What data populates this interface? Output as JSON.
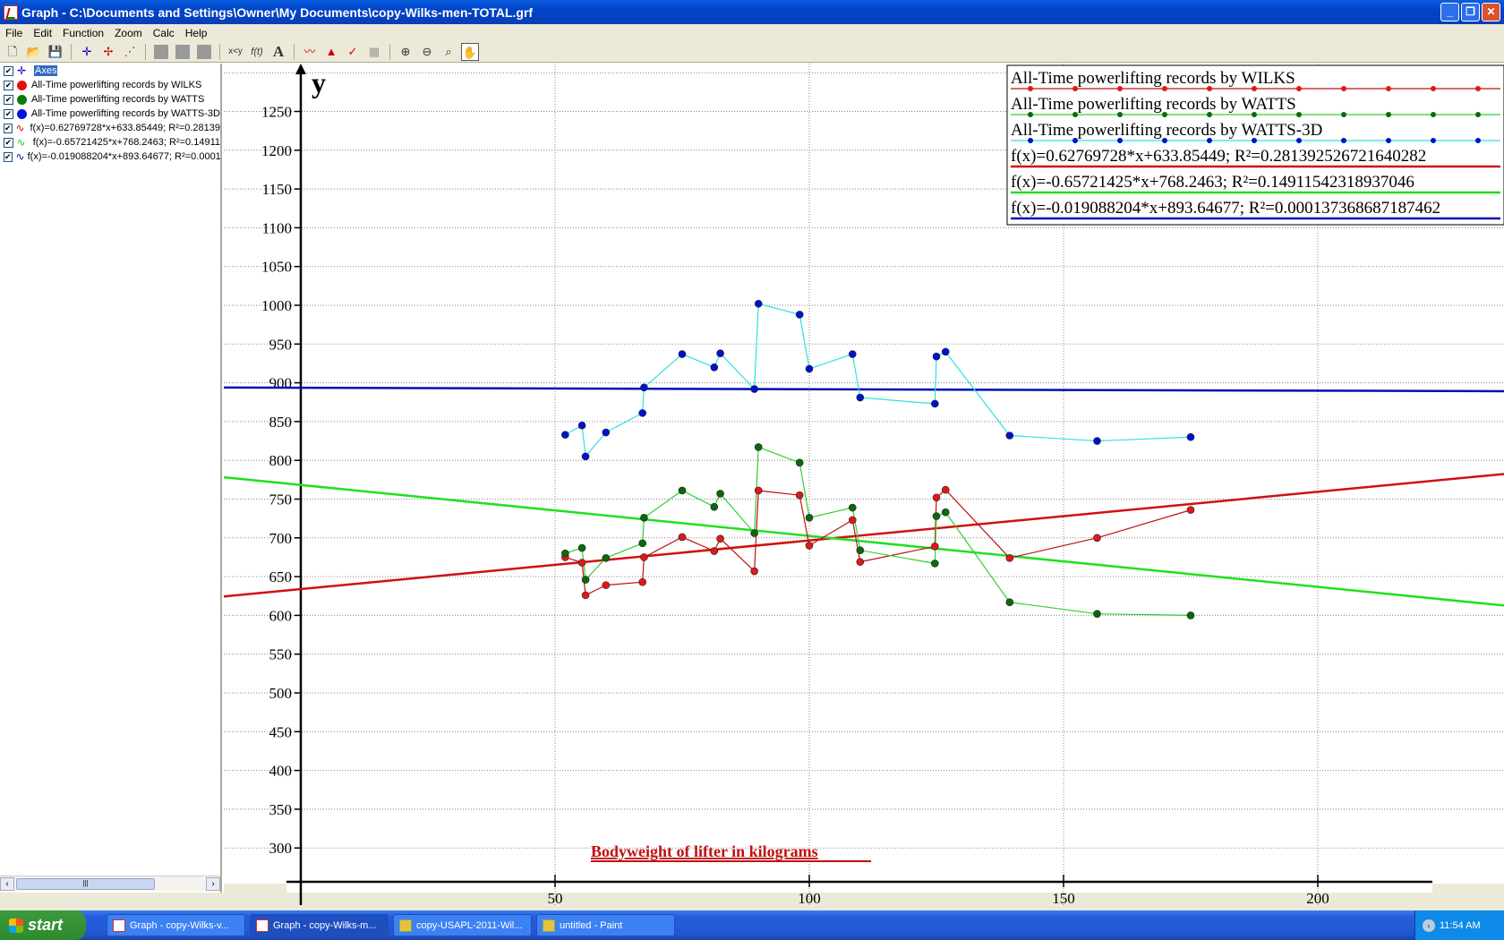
{
  "window": {
    "title": "Graph - C:\\Documents and Settings\\Owner\\My Documents\\copy-Wilks-men-TOTAL.grf",
    "buttons": [
      "minimize",
      "restore",
      "close"
    ]
  },
  "menu": [
    "File",
    "Edit",
    "Function",
    "Zoom",
    "Calc",
    "Help"
  ],
  "toolbar": {
    "text_buttons": [
      "x<y",
      "f(t)",
      "A"
    ]
  },
  "sidebar": {
    "items": [
      {
        "label": "Axes",
        "type": "axes",
        "color": "#0000c0",
        "selected": true
      },
      {
        "label": "All-Time powerlifting records by WILKS",
        "type": "point",
        "color": "#e01010"
      },
      {
        "label": "All-Time powerlifting records by WATTS",
        "type": "point",
        "color": "#0a7a0a"
      },
      {
        "label": "All-Time powerlifting records by WATTS-3D",
        "type": "point",
        "color": "#0010e0"
      },
      {
        "label": "f(x)=0.62769728*x+633.85449; R²=0.28139",
        "type": "func",
        "color": "#d01010"
      },
      {
        "label": "f(x)=-0.65721425*x+768.2463; R²=0.14911",
        "type": "func",
        "color": "#20d020"
      },
      {
        "label": "f(x)=-0.019088204*x+893.64677; R²=0.0001",
        "type": "func",
        "color": "#0010b0"
      }
    ]
  },
  "taskbar": {
    "start": "start",
    "tasks": [
      {
        "label": "Graph - copy-Wilks-v...",
        "icon": "graph",
        "active": false
      },
      {
        "label": "Graph - copy-Wilks-m...",
        "icon": "graph",
        "active": true
      },
      {
        "label": "copy-USAPL-2011-Wil...",
        "icon": "paint",
        "active": false
      },
      {
        "label": "untitled - Paint",
        "icon": "paint",
        "active": false
      }
    ],
    "clock": "11:54 AM"
  },
  "chart_data": {
    "type": "scatter",
    "title": "",
    "xlabel": "Bodyweight  of  lifter  in  kilograms",
    "ylabel": "y",
    "xlim": [
      -4,
      218
    ],
    "ylim": [
      250,
      1290
    ],
    "xticks": [
      50,
      100,
      150,
      200
    ],
    "yticks": [
      300,
      350,
      400,
      450,
      500,
      550,
      600,
      650,
      700,
      750,
      800,
      850,
      900,
      950,
      1000,
      1050,
      1100,
      1150,
      1200,
      1250
    ],
    "grid": true,
    "legend_position": "top-right",
    "series": [
      {
        "name": "All-Time powerlifting records by WILKS",
        "line_color": "#c01010",
        "marker_color": "#e01818",
        "x": [
          52,
          55.3,
          56,
          60,
          67.2,
          67.5,
          75,
          81.3,
          82.5,
          89.2,
          90,
          98.1,
          100,
          108.5,
          110,
          124.7,
          125,
          126.8,
          139.4,
          156.6,
          175
        ],
        "y": [
          675,
          668,
          626,
          639,
          643,
          675,
          701,
          683,
          699,
          657,
          761,
          755,
          690,
          723,
          669,
          689,
          752,
          762,
          674,
          700,
          736
        ]
      },
      {
        "name": "All-Time powerlifting records by WATTS",
        "line_color": "#30d030",
        "marker_color": "#0a6a0a",
        "x": [
          52,
          55.3,
          56,
          60,
          67.2,
          67.5,
          75,
          81.3,
          82.5,
          89.2,
          90,
          98.1,
          100,
          108.5,
          110,
          124.7,
          125,
          126.8,
          139.4,
          156.6,
          175
        ],
        "y": [
          680,
          687,
          646,
          674,
          693,
          726,
          761,
          740,
          757,
          706,
          817,
          797,
          726,
          739,
          684,
          667,
          728,
          733,
          617,
          602,
          600
        ]
      },
      {
        "name": "All-Time powerlifting records by WATTS-3D",
        "line_color": "#30e0e0",
        "marker_color": "#0010d0",
        "x": [
          52,
          55.3,
          56,
          60,
          67.2,
          67.5,
          75,
          81.3,
          82.5,
          89.2,
          90,
          98.1,
          100,
          108.5,
          110,
          124.7,
          125,
          126.8,
          139.4,
          156.6,
          175
        ],
        "y": [
          833,
          845,
          805,
          836,
          861,
          894,
          937,
          920,
          938,
          892,
          1002,
          988,
          918,
          937,
          881,
          873,
          934,
          940,
          832,
          825,
          830
        ]
      }
    ],
    "trendlines": [
      {
        "label": "f(x)=0.62769728*x+633.85449; R²=0.281392526721640282",
        "slope": 0.62769728,
        "intercept": 633.85449,
        "color": "#d01010"
      },
      {
        "label": "f(x)=-0.65721425*x+768.2463; R²=0.14911542318937046",
        "slope": -0.65721425,
        "intercept": 768.2463,
        "color": "#20e020"
      },
      {
        "label": "f(x)=-0.019088204*x+893.64677; R²=0.000137368687187462",
        "slope": -0.019088204,
        "intercept": 893.64677,
        "color": "#0010b0"
      }
    ]
  }
}
